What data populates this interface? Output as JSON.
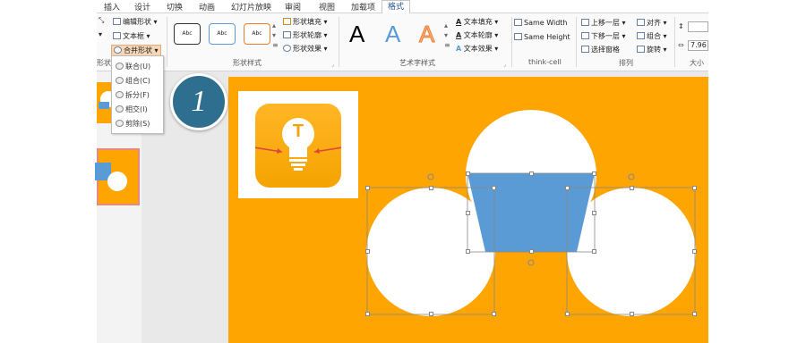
{
  "colors": {
    "orange": "#FFA502",
    "accent_blue": "#5B9BD5",
    "badge": "#2E6E8E"
  },
  "tabs": [
    "插入",
    "设计",
    "切换",
    "动画",
    "幻灯片放映",
    "审阅",
    "视图",
    "加载项",
    "格式"
  ],
  "active_tab": "格式",
  "insert_group": {
    "edit_shape": "编辑形状",
    "textbox": "文本框",
    "merge_shapes": "合并形状",
    "label_partial": "形状"
  },
  "shape_styles": {
    "sample": "Abc",
    "fill": "形状填充",
    "outline": "形状轮廓",
    "effects": "形状效果",
    "label": "形状样式"
  },
  "wordart": {
    "letter": "A",
    "text_fill": "文本填充",
    "text_outline": "文本轮廓",
    "text_effects": "文本效果",
    "label": "艺术字样式"
  },
  "thinkcell": {
    "same_width": "Same Width",
    "same_height": "Same Height",
    "label": "think-cell"
  },
  "arrange": {
    "bring_forward": "上移一层",
    "send_backward": "下移一层",
    "selection_pane": "选择窗格",
    "align": "对齐",
    "group": "组合",
    "rotate": "旋转",
    "label": "排列"
  },
  "size": {
    "width_value": "7.96",
    "label": "大小"
  },
  "merge_menu": [
    "联合(U)",
    "组合(C)",
    "拆分(F)",
    "相交(I)",
    "剪除(S)"
  ],
  "step_badge": "1",
  "bulb_letter": "T"
}
